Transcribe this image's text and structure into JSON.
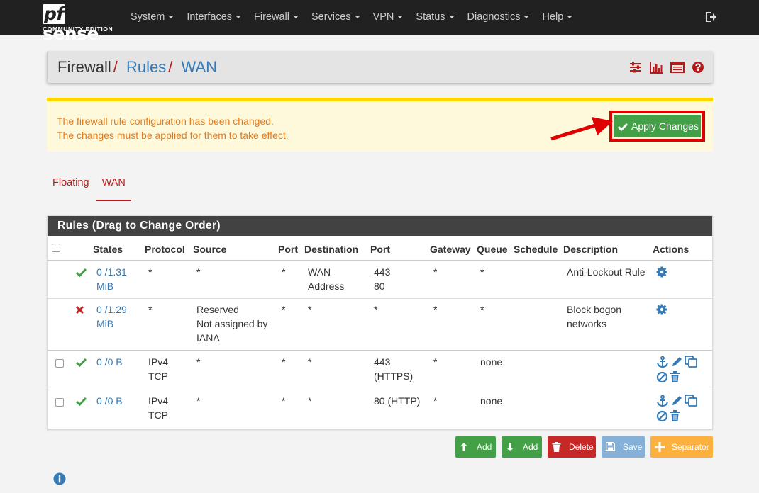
{
  "navbar": {
    "brand_main": "sense",
    "brand_pf": "pf",
    "brand_sub": "COMMUNITY EDITION",
    "menu": [
      "System",
      "Interfaces",
      "Firewall",
      "Services",
      "VPN",
      "Status",
      "Diagnostics",
      "Help"
    ]
  },
  "breadcrumb": {
    "items": [
      "Firewall",
      "Rules",
      "WAN"
    ],
    "separator": "/"
  },
  "alert": {
    "line1": "The firewall rule configuration has been changed.",
    "line2": "The changes must be applied for them to take effect.",
    "apply_label": "Apply Changes"
  },
  "tabs": [
    "Floating",
    "WAN"
  ],
  "rules": {
    "title": "Rules (Drag to Change Order)",
    "columns": [
      "States",
      "Protocol",
      "Source",
      "Port",
      "Destination",
      "Port",
      "Gateway",
      "Queue",
      "Schedule",
      "Description",
      "Actions"
    ],
    "rows": [
      {
        "states_l1": "0 /1.31",
        "states_l2": "MiB",
        "protocol_l1": "*",
        "protocol_l2": "",
        "source_l1": "*",
        "source_l2": "",
        "source_l3": "",
        "sport": "*",
        "dest_l1": "WAN",
        "dest_l2": "Address",
        "dport_l1": "443",
        "dport_l2": "80",
        "gateway": "*",
        "queue": "*",
        "schedule": "",
        "desc_l1": "Anti-Lockout Rule",
        "desc_l2": "",
        "status": "pass"
      },
      {
        "states_l1": "0 /1.29",
        "states_l2": "MiB",
        "protocol_l1": "*",
        "protocol_l2": "",
        "source_l1": "Reserved",
        "source_l2": "Not assigned by",
        "source_l3": "IANA",
        "sport": "*",
        "dest_l1": "*",
        "dest_l2": "",
        "dport_l1": "*",
        "dport_l2": "",
        "gateway": "*",
        "queue": "*",
        "schedule": "",
        "desc_l1": "Block bogon",
        "desc_l2": "networks",
        "status": "block"
      },
      {
        "states_l1": "0 /0 B",
        "states_l2": "",
        "protocol_l1": "IPv4",
        "protocol_l2": "TCP",
        "source_l1": "*",
        "source_l2": "",
        "source_l3": "",
        "sport": "*",
        "dest_l1": "*",
        "dest_l2": "",
        "dport_l1": "443",
        "dport_l2": "(HTTPS)",
        "gateway": "*",
        "queue": "none",
        "schedule": "",
        "desc_l1": "",
        "desc_l2": "",
        "status": "pass"
      },
      {
        "states_l1": "0 /0 B",
        "states_l2": "",
        "protocol_l1": "IPv4",
        "protocol_l2": "TCP",
        "source_l1": "*",
        "source_l2": "",
        "source_l3": "",
        "sport": "*",
        "dest_l1": "*",
        "dest_l2": "",
        "dport_l1": "80 (HTTP)",
        "dport_l2": "",
        "gateway": "*",
        "queue": "none",
        "schedule": "",
        "desc_l1": "",
        "desc_l2": "",
        "status": "pass"
      }
    ]
  },
  "buttons": {
    "add_top": "Add",
    "add_bottom": "Add",
    "delete": "Delete",
    "save": "Save",
    "separator": "Separator"
  },
  "colors": {
    "navbar": "#212121",
    "accent_red": "#b71c1c",
    "link_blue": "#337ab7",
    "pass_green": "#43a047",
    "block_red": "#c62828",
    "alert_text": "#e87a17",
    "alert_bg": "#fff9dc",
    "alert_border": "#ffd600"
  }
}
